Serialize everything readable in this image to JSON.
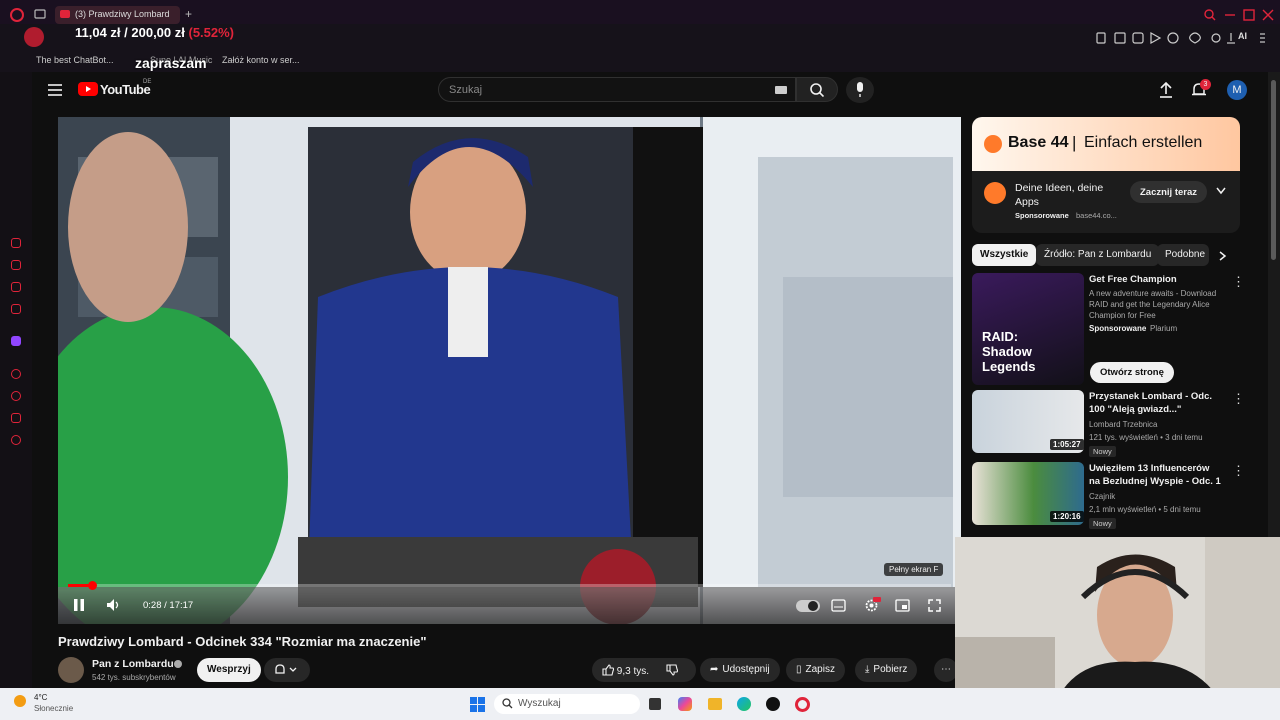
{
  "browser": {
    "tab_title": "(3) Prawdziwy Lombard",
    "bookmarks": [
      "The best ChatBot...",
      "Suno | AI Music",
      "Załóż konto w ser..."
    ]
  },
  "overlay": {
    "price_text": "11,04 zł / 200,00 zł",
    "price_change": "(5.52%)",
    "banner_text": "zapraszam"
  },
  "youtube": {
    "logo_text": "YouTube",
    "logo_region": "DE",
    "search_placeholder": "Szukaj",
    "notification_count": "3",
    "avatar_letter": "M"
  },
  "player": {
    "time": "0:28 / 17:17",
    "progress_fraction": 0.027,
    "fullscreen_tooltip": "Pełny ekran",
    "fullscreen_key": "F"
  },
  "video": {
    "title": "Prawdziwy Lombard - Odcinek 334 \"Rozmiar ma znaczenie\"",
    "channel": "Pan z Lombardu",
    "subscribers": "542 tys. subskrybentów",
    "support_label": "Wesprzyj",
    "likes": "9,3 tys.",
    "share_label": "Udostępnij",
    "save_label": "Zapisz",
    "download_label": "Pobierz"
  },
  "ad": {
    "banner_brand": "Base 44",
    "banner_slogan": "Einfach erstellen",
    "headline": "Deine Ideen, deine Apps",
    "sponsored": "Sponsorowane",
    "domain": "base44.co...",
    "cta": "Zacznij teraz"
  },
  "chips": [
    "Wszystkie",
    "Źródło: Pan z Lombardu",
    "Podobne"
  ],
  "recommendations": [
    {
      "title": "Get Free Champion",
      "desc": "A new adventure awaits - Download RAID and get the Legendary Alice Champion for Free",
      "sponsored": "Sponsorowane",
      "advertiser": "Plarium",
      "cta": "Otwórz stronę",
      "thumb_text": "RAID: Shadow Legends"
    },
    {
      "title": "Przystanek Lombard - Odc. 100 \"Aleją gwiazd...\"",
      "channel": "Lombard Trzebnica",
      "meta": "121 tys. wyświetleń • 3 dni temu",
      "badge": "Nowy",
      "duration": "1:05:27"
    },
    {
      "title": "Uwięziłem 13 Influencerów na Bezludnej Wyspie - Odc. 1",
      "channel": "Czajnik",
      "meta": "2,1 mln wyświetleń • 5 dni temu",
      "badge": "Nowy",
      "duration": "1:20:16"
    }
  ],
  "taskbar": {
    "temperature": "4°C",
    "weather": "Słonecznie",
    "search_placeholder": "Wyszukaj"
  },
  "colors": {
    "yt_red": "#ff0000",
    "opera_red": "#e0243a",
    "yt_bg": "#0f0f0f"
  }
}
